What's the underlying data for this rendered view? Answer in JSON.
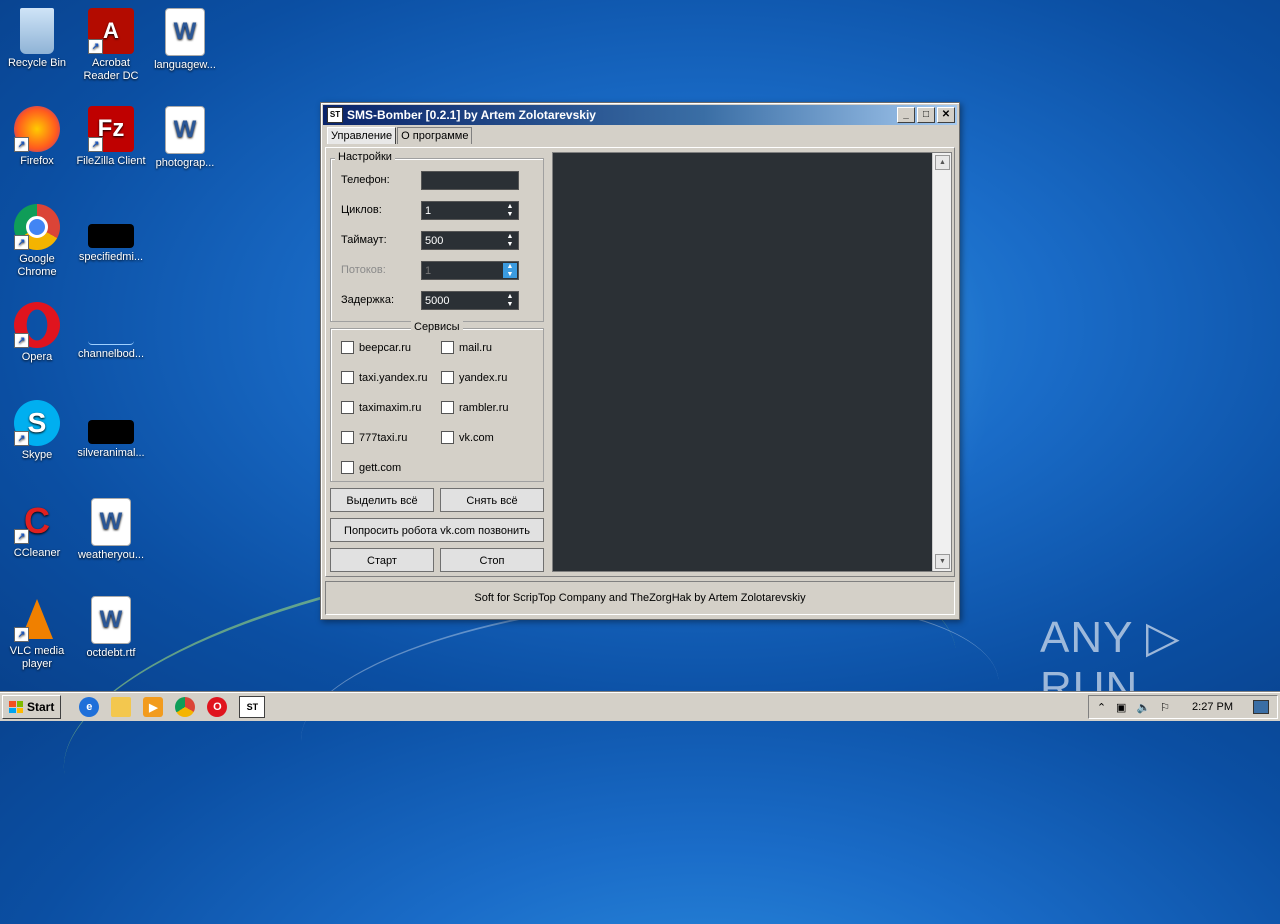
{
  "desktop": {
    "icons": [
      {
        "label": "Recycle Bin",
        "icon": "recycle-bin-icon"
      },
      {
        "label": "Acrobat Reader DC",
        "icon": "acrobat-icon"
      },
      {
        "label": "languagew...",
        "icon": "word-doc-icon"
      },
      {
        "label": "Firefox",
        "icon": "firefox-icon"
      },
      {
        "label": "FileZilla Client",
        "icon": "filezilla-icon"
      },
      {
        "label": "photograp...",
        "icon": "word-doc-icon"
      },
      {
        "label": "Google Chrome",
        "icon": "chrome-icon"
      },
      {
        "label": "specifiedmi...",
        "icon": "black-file-icon"
      },
      {
        "label": "Opera",
        "icon": "opera-icon"
      },
      {
        "label": "channelbod...",
        "icon": "blank-file-icon"
      },
      {
        "label": "Skype",
        "icon": "skype-icon"
      },
      {
        "label": "silveranimal...",
        "icon": "black-file-icon"
      },
      {
        "label": "CCleaner",
        "icon": "ccleaner-icon"
      },
      {
        "label": "weatheryou...",
        "icon": "word-doc-icon"
      },
      {
        "label": "VLC media player",
        "icon": "vlc-icon"
      },
      {
        "label": "octdebt.rtf",
        "icon": "word-doc-icon"
      }
    ]
  },
  "window": {
    "title": "SMS-Bomber [0.2.1] by Artem Zolotarevskiy",
    "app_icon_text": "ST",
    "minimize": "_",
    "maximize": "□",
    "close": "✕",
    "tabs": [
      "Управление",
      "О программе"
    ],
    "settings": {
      "title": "Настройки",
      "phone_label": "Телефон:",
      "phone_value": "",
      "cycles_label": "Циклов:",
      "cycles_value": "1",
      "timeout_label": "Таймаут:",
      "timeout_value": "500",
      "threads_label": "Потоков:",
      "threads_value": "1",
      "delay_label": "Задержка:",
      "delay_value": "5000"
    },
    "services": {
      "title": "Сервисы",
      "items": [
        "beepcar.ru",
        "mail.ru",
        "taxi.yandex.ru",
        "yandex.ru",
        "taximaxim.ru",
        "rambler.ru",
        "777taxi.ru",
        "vk.com",
        "gett.com"
      ]
    },
    "buttons": {
      "select_all": "Выделить всё",
      "deselect_all": "Снять всё",
      "ask_robot": "Попросить робота vk.com позвонить",
      "start": "Старт",
      "stop": "Стоп"
    },
    "status": "Soft for ScripTop Company and TheZorgHak by Artem Zolotarevskiy"
  },
  "watermark": "ANY ▷ RUN",
  "taskbar": {
    "start_label": "Start",
    "active_app": "ST",
    "clock": "2:27 PM"
  }
}
